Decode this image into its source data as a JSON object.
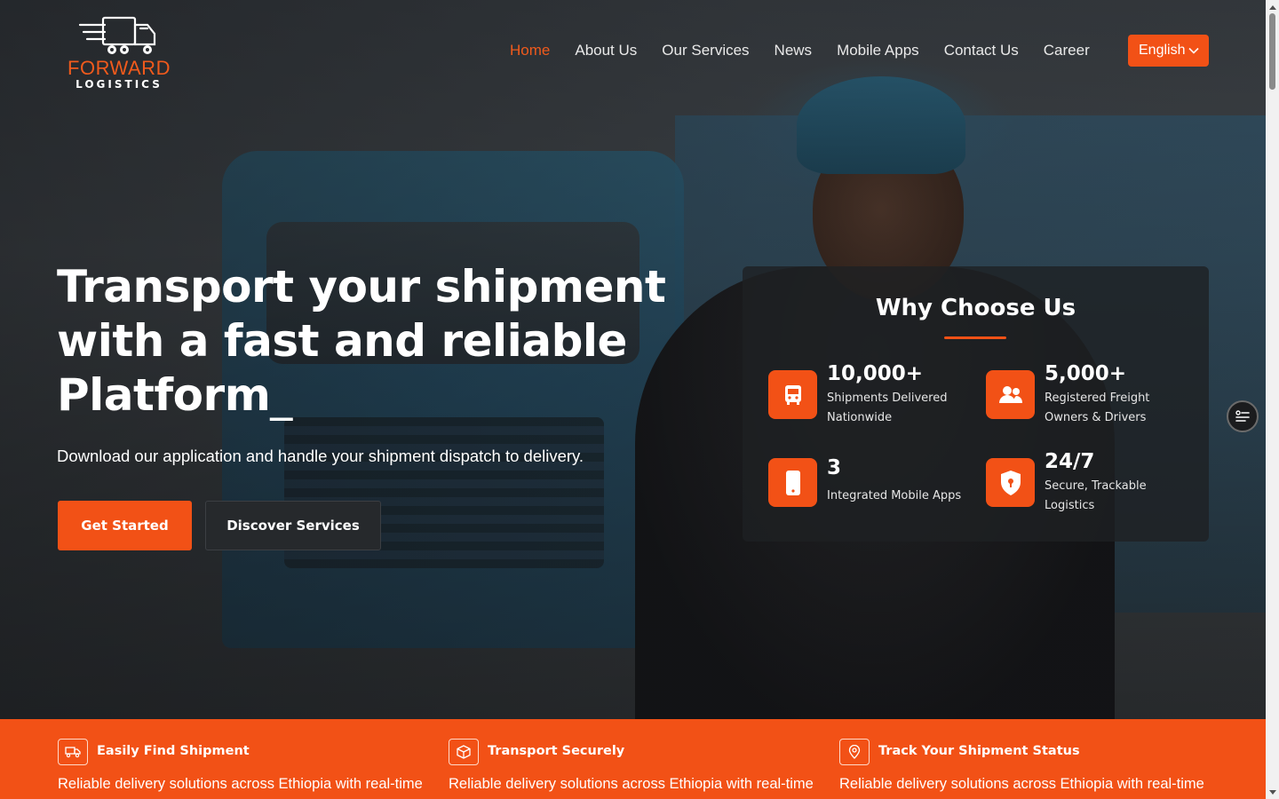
{
  "brand": {
    "name_line1": "FORWARD",
    "name_line2": "LOGISTICS",
    "accent_color": "#f25116"
  },
  "nav": {
    "items": [
      {
        "label": "Home",
        "active": true
      },
      {
        "label": "About Us",
        "active": false
      },
      {
        "label": "Our Services",
        "active": false
      },
      {
        "label": "News",
        "active": false
      },
      {
        "label": "Mobile Apps",
        "active": false
      },
      {
        "label": "Contact Us",
        "active": false
      },
      {
        "label": "Career",
        "active": false
      }
    ],
    "language": {
      "selected": "English",
      "icon": "chevron-down-icon"
    }
  },
  "hero": {
    "title_line1": "Transport your shipment",
    "title_line2": "with a fast and reliable",
    "title_line3": "Platform",
    "cursor": "_",
    "subtitle": "Download our application and handle your shipment dispatch to delivery.",
    "primary_button": "Get Started",
    "secondary_button": "Discover Services"
  },
  "why_choose_us": {
    "title": "Why Choose Us",
    "stats": [
      {
        "value": "10,000+",
        "label": "Shipments Delivered Nationwide",
        "icon": "bus-icon"
      },
      {
        "value": "5,000+",
        "label": "Registered Freight Owners & Drivers",
        "icon": "users-icon"
      },
      {
        "value": "3",
        "label": "Integrated Mobile Apps",
        "icon": "mobile-phone-icon"
      },
      {
        "value": "24/7",
        "label": "Secure, Trackable Logistics",
        "icon": "shield-lock-icon"
      }
    ]
  },
  "features": [
    {
      "title": "Easily Find Shipment",
      "description": "Reliable delivery solutions across Ethiopia with real-time",
      "icon": "truck-icon"
    },
    {
      "title": "Transport Securely",
      "description": "Reliable delivery solutions across Ethiopia with real-time",
      "icon": "package-icon"
    },
    {
      "title": "Track Your Shipment Status",
      "description": "Reliable delivery solutions across Ethiopia with real-time",
      "icon": "location-pin-icon"
    }
  ]
}
